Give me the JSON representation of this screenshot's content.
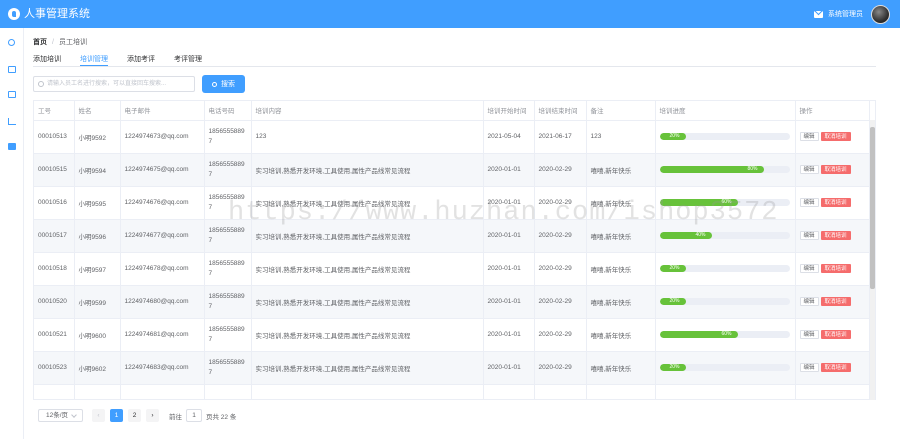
{
  "app": {
    "title": "人事管理系统"
  },
  "header": {
    "user_label": "系统管理员"
  },
  "sidebar": {
    "icons": [
      "user-icon",
      "id-card-icon",
      "card-icon",
      "chart-icon",
      "windows-icon"
    ]
  },
  "breadcrumb": {
    "home": "首页",
    "current": "员工培训"
  },
  "tabs": [
    {
      "label": "添加培训",
      "active": false
    },
    {
      "label": "培训管理",
      "active": true
    },
    {
      "label": "添加考评",
      "active": false
    },
    {
      "label": "考评管理",
      "active": false
    }
  ],
  "search": {
    "placeholder": "请输入员工名进行搜索，可以直接回车搜索...",
    "button_label": "搜索"
  },
  "table": {
    "headers": [
      "工号",
      "姓名",
      "电子邮件",
      "电话号码",
      "培训内容",
      "培训开始时间",
      "培训结束时间",
      "备注",
      "培训进度",
      "操作"
    ],
    "edit_label": "编辑",
    "cancel_label": "取消培训",
    "rows": [
      {
        "id": "00010513",
        "name": "小明9592",
        "email": "1224974673@qq.com",
        "phone": "18565558897",
        "content": "123",
        "start": "2021-05-04",
        "end": "2021-06-17",
        "note": "123",
        "progress": 20,
        "progress_text": "20%"
      },
      {
        "id": "00010515",
        "name": "小明9594",
        "email": "1224974675@qq.com",
        "phone": "18565558897",
        "content": "实习培训,熟悉开发环境,工具使用,属性产品线常见流程",
        "start": "2020-01-01",
        "end": "2020-02-29",
        "note": "嘻嘻,新年快乐",
        "progress": 80,
        "progress_text": "80%"
      },
      {
        "id": "00010516",
        "name": "小明9595",
        "email": "1224974676@qq.com",
        "phone": "18565558897",
        "content": "实习培训,熟悉开发环境,工具使用,属性产品线常见流程",
        "start": "2020-01-01",
        "end": "2020-02-29",
        "note": "嘻嘻,新年快乐",
        "progress": 60,
        "progress_text": "60%"
      },
      {
        "id": "00010517",
        "name": "小明9596",
        "email": "1224974677@qq.com",
        "phone": "18565558897",
        "content": "实习培训,熟悉开发环境,工具使用,属性产品线常见流程",
        "start": "2020-01-01",
        "end": "2020-02-29",
        "note": "嘻嘻,新年快乐",
        "progress": 40,
        "progress_text": "40%"
      },
      {
        "id": "00010518",
        "name": "小明9597",
        "email": "1224974678@qq.com",
        "phone": "18565558897",
        "content": "实习培训,熟悉开发环境,工具使用,属性产品线常见流程",
        "start": "2020-01-01",
        "end": "2020-02-29",
        "note": "嘻嘻,新年快乐",
        "progress": 20,
        "progress_text": "20%"
      },
      {
        "id": "00010520",
        "name": "小明9599",
        "email": "1224974680@qq.com",
        "phone": "18565558897",
        "content": "实习培训,熟悉开发环境,工具使用,属性产品线常见流程",
        "start": "2020-01-01",
        "end": "2020-02-29",
        "note": "嘻嘻,新年快乐",
        "progress": 20,
        "progress_text": "20%"
      },
      {
        "id": "00010521",
        "name": "小明9600",
        "email": "1224974681@qq.com",
        "phone": "18565558897",
        "content": "实习培训,熟悉开发环境,工具使用,属性产品线常见流程",
        "start": "2020-01-01",
        "end": "2020-02-29",
        "note": "嘻嘻,新年快乐",
        "progress": 60,
        "progress_text": "60%"
      },
      {
        "id": "00010523",
        "name": "小明9602",
        "email": "1224974683@qq.com",
        "phone": "18565558897",
        "content": "实习培训,熟悉开发环境,工具使用,属性产品线常见流程",
        "start": "2020-01-01",
        "end": "2020-02-29",
        "note": "嘻嘻,新年快乐",
        "progress": 20,
        "progress_text": "20%"
      },
      {
        "id": "",
        "name": "",
        "email": "",
        "phone": "",
        "content": "",
        "start": "",
        "end": "",
        "note": "",
        "progress": 0,
        "progress_text": ""
      }
    ]
  },
  "pagination": {
    "page_size": "12条/页",
    "pages": [
      "1",
      "2"
    ],
    "current": "1",
    "goto_label": "前往",
    "goto_value": "1",
    "total_suffix": "页共 22 条"
  },
  "watermark": "https://www.huzhan.com/ishop3572",
  "colors": {
    "primary": "#409eff",
    "success": "#67c23a",
    "danger": "#f56c6c"
  }
}
